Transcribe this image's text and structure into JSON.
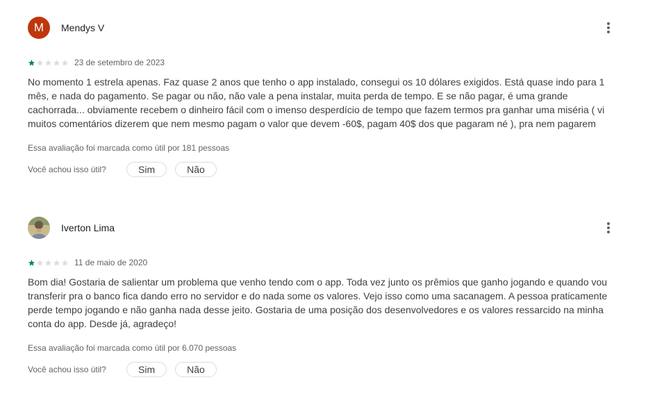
{
  "reviews": [
    {
      "reviewer": "Mendys V",
      "avatar_letter": "M",
      "avatar_color": "#bf360c",
      "rating": 1,
      "rating_max": 5,
      "date": "23 de setembro de 2023",
      "text": "No momento 1 estrela apenas. Faz quase 2 anos que tenho o app instalado, consegui os 10 dólares exigidos. Está quase indo para 1 mês, e nada do pagamento. Se pagar ou não, não vale a pena instalar, muita perda de tempo. E se não pagar, é uma grande cachorrada... obviamente recebem o dinheiro fácil com o imenso desperdício de tempo que fazem termos pra ganhar uma miséria ( vi muitos comentários dizerem que nem mesmo pagam o valor que devem -60$, pagam 40$ dos que pagaram né ), pra nem pagarem",
      "helpful_count_text": "Essa avaliação foi marcada como útil por 181 pessoas",
      "helpful_question": "Você achou isso útil?",
      "yes_label": "Sim",
      "no_label": "Não"
    },
    {
      "reviewer": "Iverton Lima",
      "avatar_icon": "user-photo-icon",
      "rating": 1,
      "rating_max": 5,
      "date": "11 de maio de 2020",
      "text": "Bom dia! Gostaria de salientar um problema que venho tendo com o app. Toda vez junto os prêmios que ganho jogando e quando vou transferir pra o banco fica dando erro no servidor e do nada some os valores. Vejo isso como uma sacanagem. A pessoa praticamente perde tempo jogando e não ganha nada desse jeito. Gostaria de uma posição dos desenvolvedores e os valores ressarcido na minha conta do app. Desde já, agradeço!",
      "helpful_count_text": "Essa avaliação foi marcada como útil por 6.070 pessoas",
      "helpful_question": "Você achou isso útil?",
      "yes_label": "Sim",
      "no_label": "Não"
    }
  ],
  "colors": {
    "star_filled": "#01875f",
    "star_empty": "#dadce0",
    "more_icon": "#5f6368"
  }
}
